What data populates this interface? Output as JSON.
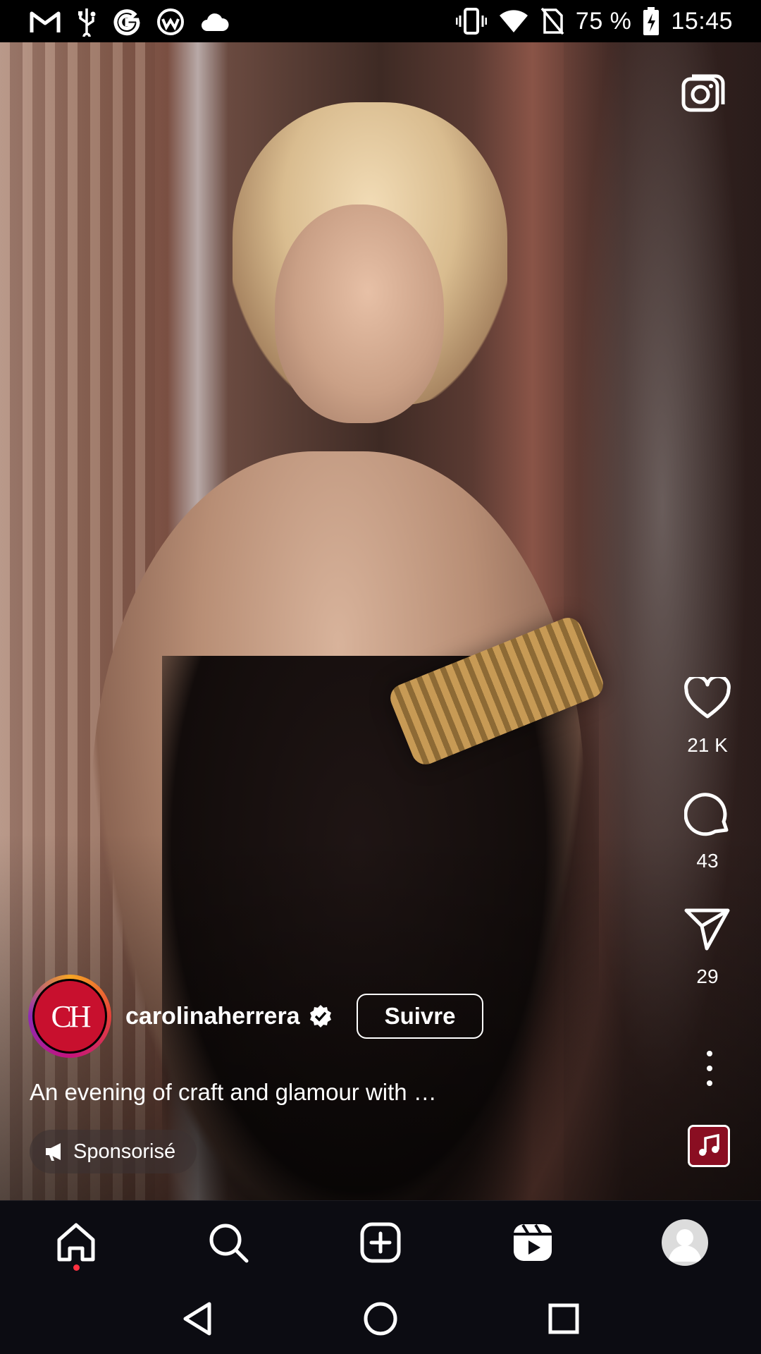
{
  "status_bar": {
    "battery": "75 %",
    "time": "15:45",
    "left_icons": [
      "gmail-icon",
      "usb-icon",
      "google-icon",
      "app-icon",
      "cloud-icon"
    ],
    "right_icons": [
      "vibrate-icon",
      "wifi-icon",
      "no-sim-icon",
      "battery-charging-icon"
    ]
  },
  "reel": {
    "actions": {
      "likes": "21 K",
      "comments": "43",
      "shares": "29"
    },
    "author": {
      "username": "carolinaherrera",
      "avatar_monogram": "CH",
      "verified": true,
      "follow_label": "Suivre"
    },
    "caption": "An evening of craft and glamour with …",
    "sponsored_label": "Sponsorisé"
  },
  "bottom_nav": {
    "items": [
      "home-icon",
      "search-icon",
      "create-icon",
      "reels-icon",
      "profile-avatar"
    ],
    "active": "home-icon"
  },
  "colors": {
    "accent_red": "#c8102e",
    "notification_dot": "#ff3040",
    "nav_background": "#0c0c12"
  }
}
